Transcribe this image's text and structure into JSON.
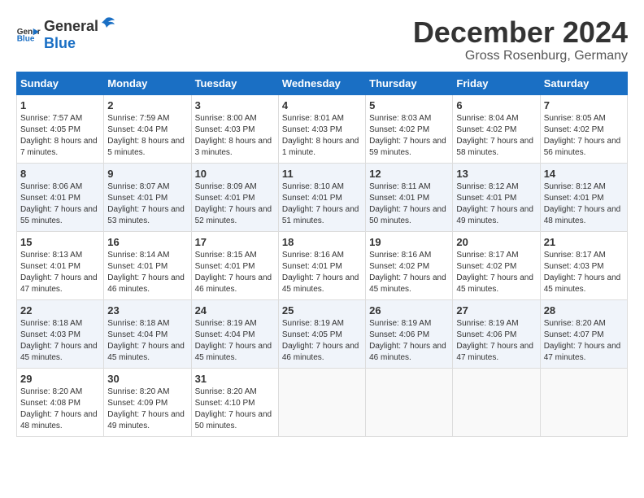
{
  "logo": {
    "general": "General",
    "blue": "Blue"
  },
  "title": "December 2024",
  "subtitle": "Gross Rosenburg, Germany",
  "weekdays": [
    "Sunday",
    "Monday",
    "Tuesday",
    "Wednesday",
    "Thursday",
    "Friday",
    "Saturday"
  ],
  "weeks": [
    [
      {
        "day": "1",
        "sunrise": "7:57 AM",
        "sunset": "4:05 PM",
        "daylight": "8 hours and 7 minutes."
      },
      {
        "day": "2",
        "sunrise": "7:59 AM",
        "sunset": "4:04 PM",
        "daylight": "8 hours and 5 minutes."
      },
      {
        "day": "3",
        "sunrise": "8:00 AM",
        "sunset": "4:03 PM",
        "daylight": "8 hours and 3 minutes."
      },
      {
        "day": "4",
        "sunrise": "8:01 AM",
        "sunset": "4:03 PM",
        "daylight": "8 hours and 1 minute."
      },
      {
        "day": "5",
        "sunrise": "8:03 AM",
        "sunset": "4:02 PM",
        "daylight": "7 hours and 59 minutes."
      },
      {
        "day": "6",
        "sunrise": "8:04 AM",
        "sunset": "4:02 PM",
        "daylight": "7 hours and 58 minutes."
      },
      {
        "day": "7",
        "sunrise": "8:05 AM",
        "sunset": "4:02 PM",
        "daylight": "7 hours and 56 minutes."
      }
    ],
    [
      {
        "day": "8",
        "sunrise": "8:06 AM",
        "sunset": "4:01 PM",
        "daylight": "7 hours and 55 minutes."
      },
      {
        "day": "9",
        "sunrise": "8:07 AM",
        "sunset": "4:01 PM",
        "daylight": "7 hours and 53 minutes."
      },
      {
        "day": "10",
        "sunrise": "8:09 AM",
        "sunset": "4:01 PM",
        "daylight": "7 hours and 52 minutes."
      },
      {
        "day": "11",
        "sunrise": "8:10 AM",
        "sunset": "4:01 PM",
        "daylight": "7 hours and 51 minutes."
      },
      {
        "day": "12",
        "sunrise": "8:11 AM",
        "sunset": "4:01 PM",
        "daylight": "7 hours and 50 minutes."
      },
      {
        "day": "13",
        "sunrise": "8:12 AM",
        "sunset": "4:01 PM",
        "daylight": "7 hours and 49 minutes."
      },
      {
        "day": "14",
        "sunrise": "8:12 AM",
        "sunset": "4:01 PM",
        "daylight": "7 hours and 48 minutes."
      }
    ],
    [
      {
        "day": "15",
        "sunrise": "8:13 AM",
        "sunset": "4:01 PM",
        "daylight": "7 hours and 47 minutes."
      },
      {
        "day": "16",
        "sunrise": "8:14 AM",
        "sunset": "4:01 PM",
        "daylight": "7 hours and 46 minutes."
      },
      {
        "day": "17",
        "sunrise": "8:15 AM",
        "sunset": "4:01 PM",
        "daylight": "7 hours and 46 minutes."
      },
      {
        "day": "18",
        "sunrise": "8:16 AM",
        "sunset": "4:01 PM",
        "daylight": "7 hours and 45 minutes."
      },
      {
        "day": "19",
        "sunrise": "8:16 AM",
        "sunset": "4:02 PM",
        "daylight": "7 hours and 45 minutes."
      },
      {
        "day": "20",
        "sunrise": "8:17 AM",
        "sunset": "4:02 PM",
        "daylight": "7 hours and 45 minutes."
      },
      {
        "day": "21",
        "sunrise": "8:17 AM",
        "sunset": "4:03 PM",
        "daylight": "7 hours and 45 minutes."
      }
    ],
    [
      {
        "day": "22",
        "sunrise": "8:18 AM",
        "sunset": "4:03 PM",
        "daylight": "7 hours and 45 minutes."
      },
      {
        "day": "23",
        "sunrise": "8:18 AM",
        "sunset": "4:04 PM",
        "daylight": "7 hours and 45 minutes."
      },
      {
        "day": "24",
        "sunrise": "8:19 AM",
        "sunset": "4:04 PM",
        "daylight": "7 hours and 45 minutes."
      },
      {
        "day": "25",
        "sunrise": "8:19 AM",
        "sunset": "4:05 PM",
        "daylight": "7 hours and 46 minutes."
      },
      {
        "day": "26",
        "sunrise": "8:19 AM",
        "sunset": "4:06 PM",
        "daylight": "7 hours and 46 minutes."
      },
      {
        "day": "27",
        "sunrise": "8:19 AM",
        "sunset": "4:06 PM",
        "daylight": "7 hours and 47 minutes."
      },
      {
        "day": "28",
        "sunrise": "8:20 AM",
        "sunset": "4:07 PM",
        "daylight": "7 hours and 47 minutes."
      }
    ],
    [
      {
        "day": "29",
        "sunrise": "8:20 AM",
        "sunset": "4:08 PM",
        "daylight": "7 hours and 48 minutes."
      },
      {
        "day": "30",
        "sunrise": "8:20 AM",
        "sunset": "4:09 PM",
        "daylight": "7 hours and 49 minutes."
      },
      {
        "day": "31",
        "sunrise": "8:20 AM",
        "sunset": "4:10 PM",
        "daylight": "7 hours and 50 minutes."
      },
      null,
      null,
      null,
      null
    ]
  ]
}
